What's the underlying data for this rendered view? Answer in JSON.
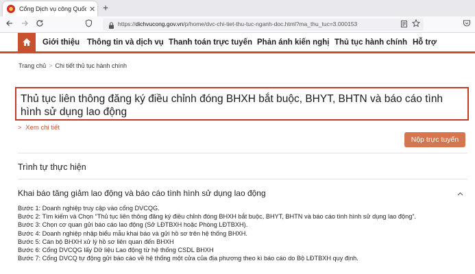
{
  "browser": {
    "tab_title": "Cổng Dịch vụ công Quốc gia",
    "tab_close": "✕",
    "new_tab": "+",
    "url_prefix": "https://",
    "url_host": "dichvucong.gov.vn",
    "url_path": "/p/home/dvc-chi-tiet-thu-tuc-nganh-doc.html?ma_thu_tuc=3.000153",
    "icons": [
      "back-arrow-icon",
      "forward-arrow-icon",
      "reload-icon",
      "shield-icon",
      "lock-icon",
      "permissions-icon",
      "reader-mode-icon",
      "bookmark-star-icon",
      "pocket-icon"
    ]
  },
  "menu": {
    "items": [
      "Giới thiệu",
      "Thông tin và dịch vụ",
      "Thanh toán trực tuyến",
      "Phản ánh kiến nghị",
      "Thủ tục hành chính",
      "Hỗ trợ"
    ],
    "accent_color": "#c94f2f"
  },
  "breadcrumb": {
    "home": "Trang chủ",
    "separator": ">",
    "current": "Chi tiết thủ tục hành chính"
  },
  "procedure": {
    "title": "Thủ tục liên thông đăng ký điều chỉnh đóng BHXH bắt buộc, BHYT, BHTN và báo cáo tình hình sử dụng lao động",
    "see_more": "Xem chi tiết",
    "submit_label": "Nộp trực tuyến",
    "border_color": "#c0392b"
  },
  "sequence": {
    "heading": "Trình tự thực hiện",
    "subheading": "Khai báo tăng giảm lao động và báo cáo tình hình sử dụng lao động",
    "steps": [
      "Bước 1: Doanh nghiệp truy cập vào cổng DVCQG.",
      "Bước 2: Tìm kiếm và Chọn “Thủ tục liên thông đăng ký điều chỉnh đóng BHXH bắt buộc, BHYT, BHTN và báo cáo tình hình sử dụng lao động”.",
      "Bước 3: Chọn cơ quan gửi báo cáo lao động (Sở LĐTBXH hoặc Phòng LĐTBXH).",
      "Bước 4: Doanh nghiệp nhập biểu mẫu khai báo và gửi hồ sơ trên hệ thống BHXH.",
      "Bước 5: Cán bộ BHXH xử lý hồ sơ liên quan đến BHXH",
      "Bước 6: Cổng DVCQG lấy Dữ liệu Lao động từ hệ thống CSDL BHXH",
      "Bước 7: Cổng DVCQ tự động gửi báo cáo về hệ thống một cửa của địa phương theo kì báo cáo do Bộ LĐTBXH quy định."
    ]
  }
}
